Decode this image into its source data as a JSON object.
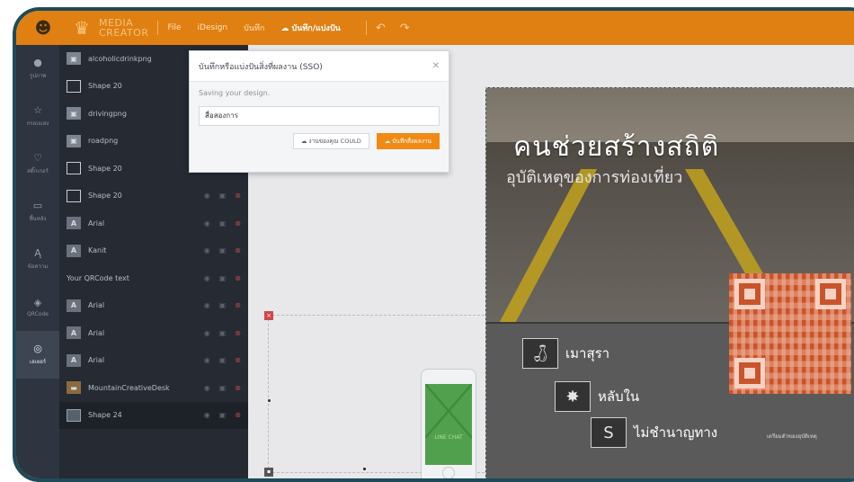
{
  "app": {
    "brand_line1": "MEDIA",
    "brand_line2": "CREATOR",
    "menu": [
      "File",
      "iDesign",
      "บันทึก",
      "บันทึก/แบ่งปัน"
    ],
    "active_menu": "บันทึก/แบ่งปัน"
  },
  "rail": [
    {
      "icon": "●",
      "label": "รูปภาพ"
    },
    {
      "icon": "☆",
      "label": "กรอบแสง"
    },
    {
      "icon": "♡",
      "label": "สติ๊กเกอร์"
    },
    {
      "icon": "▭",
      "label": "พื้นหลัง"
    },
    {
      "icon": "Ą",
      "label": "ข้อความ"
    },
    {
      "icon": "◈",
      "label": "QRCode"
    },
    {
      "icon": "◎",
      "label": "เลเยอร์"
    }
  ],
  "layers": [
    {
      "name": "alcoholicdrinkpng",
      "type": "img"
    },
    {
      "name": "Shape 20",
      "type": "shape"
    },
    {
      "name": "drivingpng",
      "type": "img"
    },
    {
      "name": "roadpng",
      "type": "img"
    },
    {
      "name": "Shape 20",
      "type": "shape"
    },
    {
      "name": "Shape 20",
      "type": "shape"
    },
    {
      "name": "Arial",
      "type": "txt"
    },
    {
      "name": "Kanit",
      "type": "txt"
    },
    {
      "name": "Your QRCode text",
      "type": "qr"
    },
    {
      "name": "Arial",
      "type": "txt"
    },
    {
      "name": "Arial",
      "type": "txt"
    },
    {
      "name": "Arial",
      "type": "txt"
    },
    {
      "name": "MountainCreativeDesk",
      "type": "desk"
    },
    {
      "name": "Shape 24",
      "type": "solid"
    }
  ],
  "modal": {
    "title": "บันทึกหรือแบ่งปันสิ่งที่ผลงาน (SSO)",
    "message": "Saving your design.",
    "input_value": "สื่อสองการ",
    "cloud_button": "☁ งานของคุณ COULD",
    "save_button": "☁ บันทึกสื่อผลงาน"
  },
  "poster": {
    "title": "คนช่วยสร้างสถิติ",
    "subtitle": "อุบัติเหตุของการท่องเที่ยว",
    "items": [
      {
        "label": "เมาสุรา"
      },
      {
        "label": "หลับใน"
      },
      {
        "label": "ไม่ชำนาญทาง"
      }
    ],
    "tag": "เตรียมตัวของอุบัติเหตุ"
  },
  "phone_label": "LINE CHAT",
  "colors": {
    "topbar": "#e07f12",
    "rail": "#2e3440",
    "panel": "#252a33",
    "accent": "#f08a14",
    "qr": "#c9542c"
  }
}
